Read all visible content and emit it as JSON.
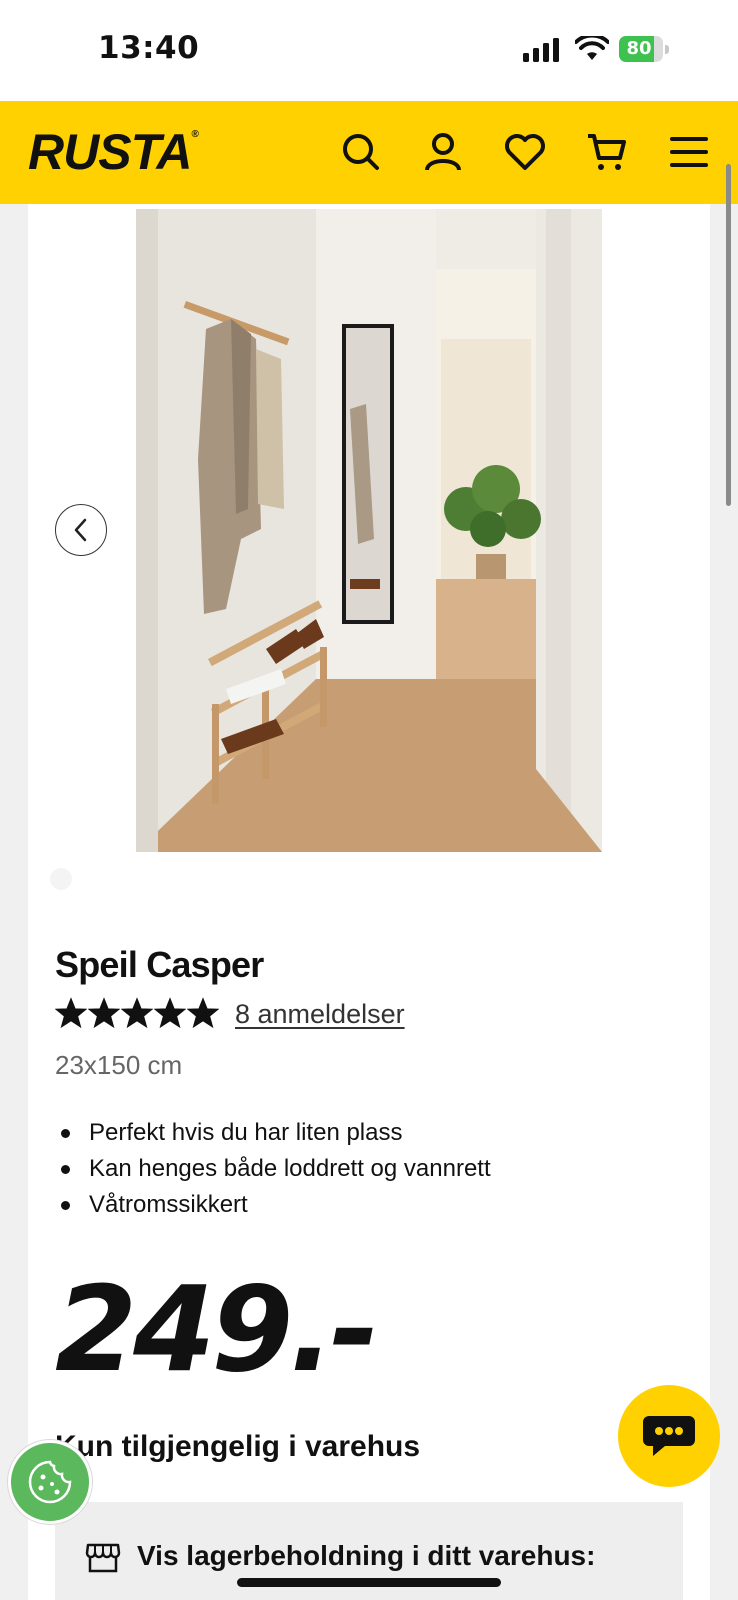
{
  "status_bar": {
    "time": "13:40",
    "battery": "80",
    "battery_level": 0.8
  },
  "header": {
    "logo": "RUSTA",
    "icons": [
      "search-icon",
      "account-icon",
      "heart-icon",
      "cart-icon",
      "menu-icon"
    ],
    "background": "#ffd100"
  },
  "product": {
    "title": "Speil Casper",
    "rating": 5,
    "reviews": "8 anmeldelser",
    "size": "23x150 cm",
    "features": [
      "Perfekt hvis du har liten plass",
      "Kan henges både loddrett og vannrett",
      "Våtromssikkert"
    ],
    "price": "249.-",
    "availability": "Kun tilgjengelig i varehus",
    "stock_label": "Vis lagerbeholdning i ditt varehus:"
  },
  "colors": {
    "accent": "#ffd100",
    "cookie": "#5cb85c"
  }
}
